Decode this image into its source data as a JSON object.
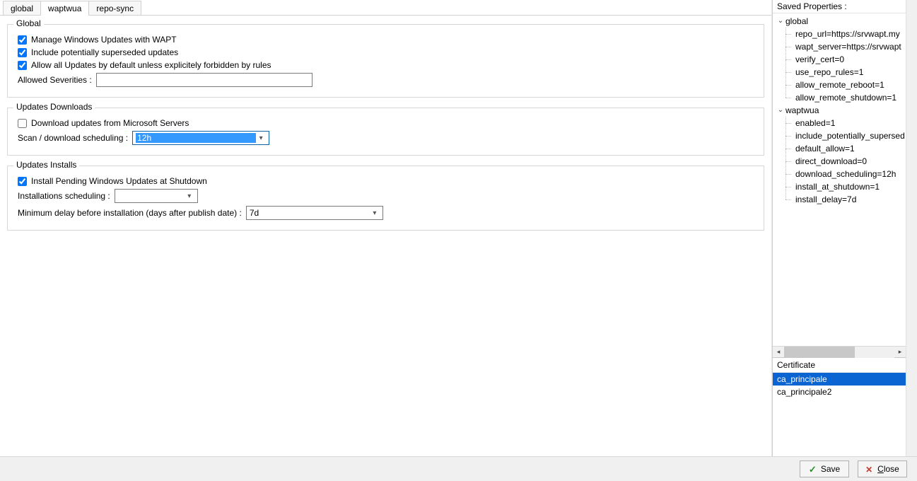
{
  "tabs": {
    "items": [
      {
        "label": "global"
      },
      {
        "label": "waptwua"
      },
      {
        "label": "repo-sync"
      }
    ],
    "active_index": 1
  },
  "group_global": {
    "title": "Global",
    "manage_wu_label": "Manage Windows Updates with WAPT",
    "manage_wu_checked": true,
    "include_superseded_label": "Include potentially superseded updates",
    "include_superseded_checked": true,
    "allow_all_label": "Allow all Updates by default unless explicitely forbidden by rules",
    "allow_all_checked": true,
    "allowed_severities_label": "Allowed Severities :",
    "allowed_severities_value": ""
  },
  "group_downloads": {
    "title": "Updates Downloads",
    "download_ms_label": "Download updates from Microsoft Servers",
    "download_ms_checked": false,
    "scan_label": "Scan / download scheduling :",
    "scan_value": "12h"
  },
  "group_installs": {
    "title": "Updates Installs",
    "install_shutdown_label": "Install Pending Windows Updates at Shutdown",
    "install_shutdown_checked": true,
    "install_sched_label": "Installations scheduling :",
    "install_sched_value": "",
    "min_delay_label": "Minimum delay before installation (days after publish date) :",
    "min_delay_value": "7d"
  },
  "right": {
    "title": "Saved Properties :",
    "sections": [
      {
        "name": "global",
        "items": [
          "repo_url=https://srvwapt.my",
          "wapt_server=https://srvwapt",
          "verify_cert=0",
          "use_repo_rules=1",
          "allow_remote_reboot=1",
          "allow_remote_shutdown=1"
        ]
      },
      {
        "name": "waptwua",
        "items": [
          "enabled=1",
          "include_potentially_supersed",
          "default_allow=1",
          "direct_download=0",
          "download_scheduling=12h",
          "install_at_shutdown=1",
          "install_delay=7d"
        ]
      }
    ],
    "cert_header": "Certificate",
    "certs": [
      {
        "label": "ca_principale",
        "selected": true
      },
      {
        "label": "ca_principale2",
        "selected": false
      }
    ]
  },
  "buttons": {
    "save": "Save",
    "close": "Close"
  }
}
